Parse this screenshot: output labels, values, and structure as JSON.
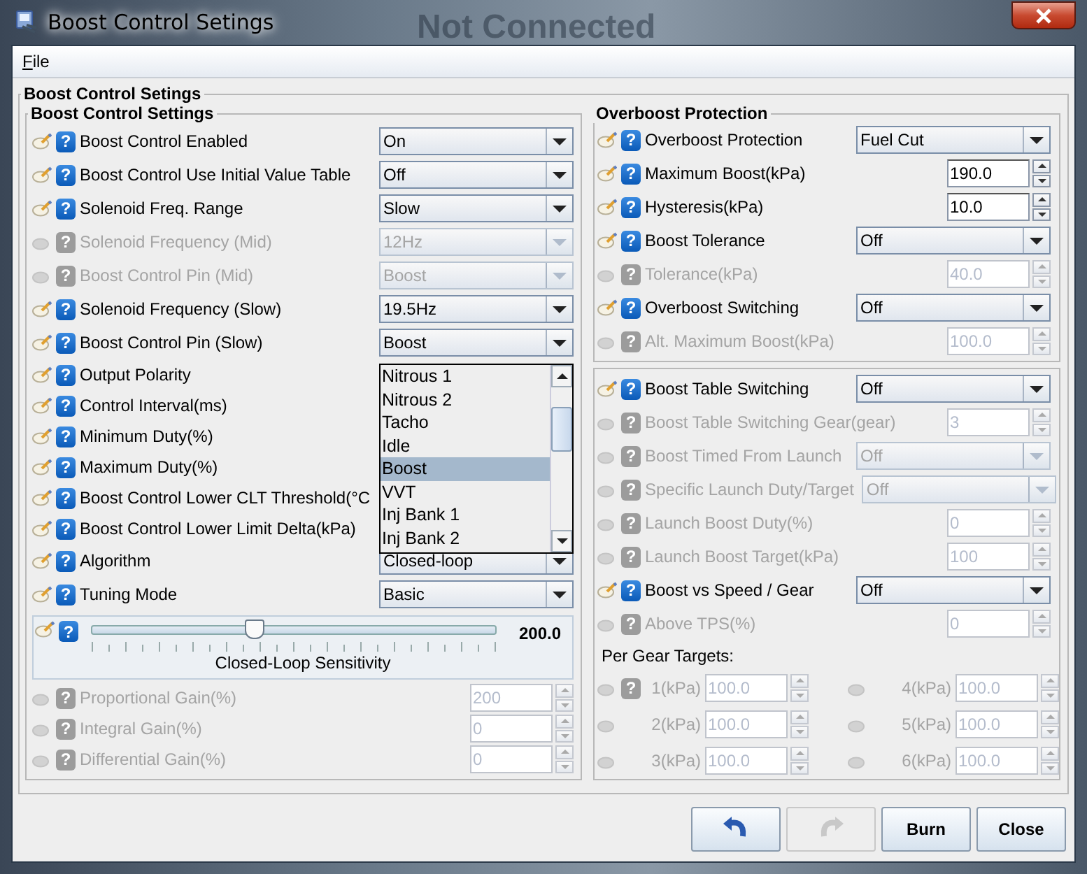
{
  "window": {
    "title": "Boost Control Setings",
    "background_text": "Not Connected"
  },
  "menu": [
    {
      "label": "File"
    }
  ],
  "outer_group": {
    "title": "Boost Control Setings"
  },
  "boost_control": {
    "title": "Boost Control Settings",
    "rows": [
      {
        "label": "Boost Control Enabled",
        "kind": "combo",
        "value": "On",
        "enabled": true,
        "help": "?"
      },
      {
        "label": "Boost Control Use Initial Value Table",
        "kind": "combo",
        "value": "Off",
        "enabled": true,
        "help": "?"
      },
      {
        "label": "Solenoid Freq. Range",
        "kind": "combo",
        "value": "Slow",
        "enabled": true,
        "help": "?"
      },
      {
        "label": "Solenoid Frequency (Mid)",
        "kind": "combo",
        "value": "12Hz",
        "enabled": false,
        "help": "?"
      },
      {
        "label": "Boost Control Pin (Mid)",
        "kind": "combo",
        "value": "Boost",
        "enabled": false,
        "help": "?"
      },
      {
        "label": "Solenoid Frequency (Slow)",
        "kind": "combo",
        "value": "19.5Hz",
        "enabled": true,
        "help": "?"
      },
      {
        "label": "Boost Control Pin (Slow)",
        "kind": "combo",
        "value": "Boost",
        "enabled": true,
        "help": "?"
      },
      {
        "label": "Output Polarity",
        "kind": "covered",
        "enabled": true,
        "help": "?"
      },
      {
        "label": "Control Interval(ms)",
        "kind": "covered",
        "enabled": true,
        "help": "?"
      },
      {
        "label": "Minimum Duty(%)",
        "kind": "covered",
        "enabled": true,
        "help": "?"
      },
      {
        "label": "Maximum Duty(%)",
        "kind": "covered",
        "enabled": true,
        "help": "?"
      },
      {
        "label": "Boost Control Lower CLT Threshold(°C",
        "kind": "covered",
        "enabled": true,
        "help": "?"
      },
      {
        "label": "Boost Control Lower Limit Delta(kPa)",
        "kind": "covered",
        "enabled": true,
        "help": "?"
      },
      {
        "label": "Algorithm",
        "kind": "combo",
        "value": "Closed-loop",
        "enabled": true,
        "help": "?"
      },
      {
        "label": "Tuning Mode",
        "kind": "combo",
        "value": "Basic",
        "enabled": true,
        "help": "?"
      }
    ],
    "dropdown_popup": {
      "options": [
        {
          "label": "Nitrous 1",
          "selected": false
        },
        {
          "label": "Nitrous 2",
          "selected": false
        },
        {
          "label": "Tacho",
          "selected": false
        },
        {
          "label": "Idle",
          "selected": false
        },
        {
          "label": "Boost",
          "selected": true
        },
        {
          "label": "VVT",
          "selected": false
        },
        {
          "label": "Inj Bank 1",
          "selected": false
        },
        {
          "label": "Inj Bank 2",
          "selected": false
        }
      ]
    },
    "slider": {
      "label": "Closed-Loop Sensitivity",
      "value": "200.0",
      "level": 0.4,
      "help": "?"
    },
    "gains": [
      {
        "label": "Proportional Gain(%)",
        "kind": "spin",
        "value": "200",
        "enabled": false,
        "help": "?"
      },
      {
        "label": "Integral Gain(%)",
        "kind": "spin",
        "value": "0",
        "enabled": false,
        "help": "?"
      },
      {
        "label": "Differential Gain(%)",
        "kind": "spin",
        "value": "0",
        "enabled": false,
        "help": "?"
      }
    ]
  },
  "overboost": {
    "title": "Overboost Protection",
    "rows": [
      {
        "label": "Overboost Protection",
        "kind": "combo",
        "value": "Fuel Cut",
        "enabled": true,
        "help": "?"
      },
      {
        "label": "Maximum Boost(kPa)",
        "kind": "spin",
        "value": "190.0",
        "enabled": true,
        "help": "?"
      },
      {
        "label": "Hysteresis(kPa)",
        "kind": "spin",
        "value": "10.0",
        "enabled": true,
        "help": "?"
      },
      {
        "label": "Boost Tolerance",
        "kind": "combo",
        "value": "Off",
        "enabled": true,
        "help": "?"
      },
      {
        "label": "Tolerance(kPa)",
        "kind": "spin",
        "value": "40.0",
        "enabled": false,
        "help": "?"
      },
      {
        "label": "Overboost Switching",
        "kind": "combo",
        "value": "Off",
        "enabled": true,
        "help": "?"
      },
      {
        "label": "Alt. Maximum Boost(kPa)",
        "kind": "spin",
        "value": "100.0",
        "enabled": false,
        "help": "?"
      }
    ]
  },
  "switching": {
    "rows": [
      {
        "label": "Boost Table Switching",
        "kind": "combo",
        "value": "Off",
        "enabled": true,
        "help": "?"
      },
      {
        "label": "Boost Table Switching Gear(gear)",
        "kind": "spin",
        "value": "3",
        "enabled": false,
        "help": "?"
      },
      {
        "label": "Boost Timed From Launch",
        "kind": "combo",
        "value": "Off",
        "enabled": false,
        "help": "?"
      },
      {
        "label": "Specific Launch Duty/Target",
        "kind": "combo",
        "value": "Off",
        "enabled": false,
        "help": "?"
      },
      {
        "label": "Launch Boost Duty(%)",
        "kind": "spin",
        "value": "0",
        "enabled": false,
        "help": "?"
      },
      {
        "label": "Launch Boost Target(kPa)",
        "kind": "spin",
        "value": "100",
        "enabled": false,
        "help": "?"
      },
      {
        "label": "Boost vs Speed / Gear",
        "kind": "combo",
        "value": "Off",
        "enabled": true,
        "help": "?"
      },
      {
        "label": "Above TPS(%)",
        "kind": "spin",
        "value": "0",
        "enabled": false,
        "help": "?"
      }
    ],
    "per_gear_title": "Per Gear Targets:",
    "gears": [
      {
        "label": "1(kPa)",
        "value": "100.0",
        "enabled": false,
        "help": "?"
      },
      {
        "label": "4(kPa)",
        "value": "100.0",
        "enabled": false
      },
      {
        "label": "2(kPa)",
        "value": "100.0",
        "enabled": false
      },
      {
        "label": "5(kPa)",
        "value": "100.0",
        "enabled": false
      },
      {
        "label": "3(kPa)",
        "value": "100.0",
        "enabled": false
      },
      {
        "label": "6(kPa)",
        "value": "100.0",
        "enabled": false
      }
    ]
  },
  "buttons": [
    {
      "kind": "undo",
      "disabled": false
    },
    {
      "kind": "redo",
      "disabled": true
    },
    {
      "kind": "text",
      "label": "Burn",
      "disabled": false
    },
    {
      "kind": "text",
      "label": "Close",
      "disabled": false
    }
  ]
}
